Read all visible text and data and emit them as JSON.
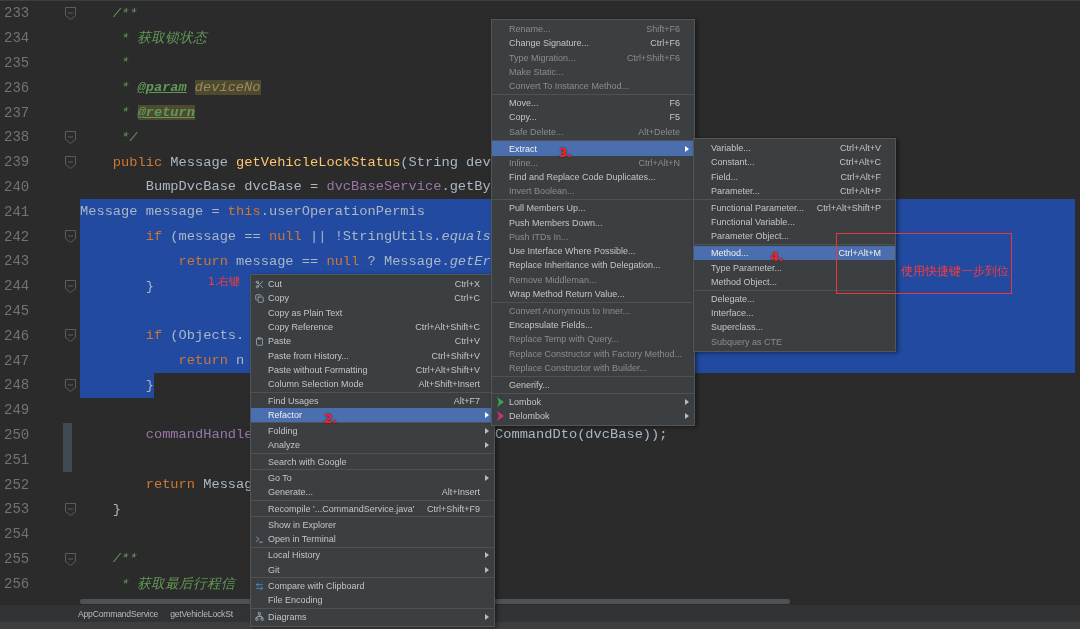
{
  "editor": {
    "lines": [
      {
        "number": "233",
        "fold": true,
        "changed": false,
        "selected": false,
        "tokens": [
          {
            "kind": "comment",
            "text": "    /**"
          }
        ]
      },
      {
        "number": "234",
        "fold": false,
        "changed": false,
        "selected": false,
        "tokens": [
          {
            "kind": "comment",
            "text": "     * 获取锁状态"
          }
        ]
      },
      {
        "number": "235",
        "fold": false,
        "changed": false,
        "selected": false,
        "tokens": [
          {
            "kind": "comment",
            "text": "     *"
          }
        ]
      },
      {
        "number": "236",
        "fold": false,
        "changed": false,
        "selected": false,
        "tokens": [
          {
            "kind": "comment",
            "text": "     * "
          },
          {
            "kind": "doctag",
            "text": "@param"
          },
          {
            "kind": "docparam_marked",
            "text": "deviceNo"
          }
        ]
      },
      {
        "number": "237",
        "fold": false,
        "changed": false,
        "selected": false,
        "tokens": [
          {
            "kind": "comment",
            "text": "     * "
          },
          {
            "kind": "doctag_marked",
            "text": "@return"
          }
        ]
      },
      {
        "number": "238",
        "fold": true,
        "changed": false,
        "selected": false,
        "tokens": [
          {
            "kind": "comment",
            "text": "     */"
          }
        ]
      },
      {
        "number": "239",
        "fold": true,
        "changed": false,
        "selected": false,
        "tokens": [
          {
            "kind": "keyword",
            "text": "    public"
          },
          {
            "kind": "plain",
            "text": " Message "
          },
          {
            "kind": "method",
            "text": "getVehicleLockStatus"
          },
          {
            "kind": "plain",
            "text": "(String dev"
          }
        ]
      },
      {
        "number": "240",
        "fold": false,
        "changed": false,
        "selected": false,
        "tokens": [
          {
            "kind": "plain",
            "text": "        BumpDvcBase dvcBase = "
          },
          {
            "kind": "field",
            "text": "dvcBaseService"
          },
          {
            "kind": "plain",
            "text": ".getBy"
          }
        ]
      },
      {
        "number": "241",
        "fold": false,
        "changed": false,
        "selected": true,
        "selection_starts_at_code": true,
        "tokens": [
          {
            "kind": "plain",
            "text": "        Message message = "
          },
          {
            "kind": "keyword",
            "text": "this"
          },
          {
            "kind": "plain",
            "text": ".userOperationPermis"
          }
        ]
      },
      {
        "number": "242",
        "fold": true,
        "changed": false,
        "selected": true,
        "tokens": [
          {
            "kind": "keyword",
            "text": "        if"
          },
          {
            "kind": "plain",
            "text": " (message == "
          },
          {
            "kind": "keyword",
            "text": "null"
          },
          {
            "kind": "plain",
            "text": " || !StringUtils."
          },
          {
            "kind": "static",
            "text": "equals"
          }
        ]
      },
      {
        "number": "243",
        "fold": false,
        "changed": false,
        "selected": true,
        "tokens": [
          {
            "kind": "keyword",
            "text": "            return"
          },
          {
            "kind": "plain",
            "text": " message == "
          },
          {
            "kind": "keyword",
            "text": "null"
          },
          {
            "kind": "plain",
            "text": " ? Message."
          },
          {
            "kind": "static",
            "text": "getEr"
          }
        ]
      },
      {
        "number": "244",
        "fold": true,
        "changed": false,
        "selected": true,
        "note": "1.右键",
        "tokens": [
          {
            "kind": "plain",
            "text": "        }"
          }
        ]
      },
      {
        "number": "245",
        "fold": false,
        "changed": false,
        "selected": true
      },
      {
        "number": "246",
        "fold": true,
        "changed": false,
        "selected": true,
        "tokens": [
          {
            "kind": "keyword",
            "text": "        if"
          },
          {
            "kind": "plain",
            "text": " (Objects."
          }
        ]
      },
      {
        "number": "247",
        "fold": false,
        "changed": false,
        "selected": true,
        "tokens": [
          {
            "kind": "keyword",
            "text": "            return"
          },
          {
            "kind": "plain",
            "text": " n"
          }
        ]
      },
      {
        "number": "248",
        "fold": true,
        "changed": false,
        "selected": true,
        "selection_ends_at_code": true,
        "tokens": [
          {
            "kind": "plain",
            "text": "        }"
          }
        ]
      },
      {
        "number": "249",
        "fold": false,
        "changed": false,
        "selected": false
      },
      {
        "number": "250",
        "fold": false,
        "changed": true,
        "selected": false,
        "tokens": [
          {
            "kind": "field",
            "text": "        commandHandle"
          }
        ],
        "tail": "CommandDto(dvcBase));"
      },
      {
        "number": "251",
        "fold": false,
        "changed": true,
        "selected": false
      },
      {
        "number": "252",
        "fold": false,
        "changed": false,
        "selected": false,
        "tokens": [
          {
            "kind": "keyword",
            "text": "        return"
          },
          {
            "kind": "plain",
            "text": " Messag"
          }
        ]
      },
      {
        "number": "253",
        "fold": true,
        "changed": false,
        "selected": false,
        "tokens": [
          {
            "kind": "plain",
            "text": "    }"
          }
        ]
      },
      {
        "number": "254",
        "fold": false,
        "changed": false,
        "selected": false
      },
      {
        "number": "255",
        "fold": true,
        "changed": false,
        "selected": false,
        "tokens": [
          {
            "kind": "comment",
            "text": "    /**"
          }
        ]
      },
      {
        "number": "256",
        "fold": false,
        "changed": false,
        "selected": false,
        "tokens": [
          {
            "kind": "comment",
            "text": "     * 获取最后行程信"
          }
        ]
      }
    ]
  },
  "breadcrumb": [
    "AppCommandService",
    "getVehicleLockSt"
  ],
  "context_menu": {
    "groups": [
      [
        {
          "label": "Cut",
          "shortcut": "Ctrl+X",
          "kind": "cut",
          "selected": false,
          "disabled": false
        },
        {
          "label": "Copy",
          "shortcut": "Ctrl+C",
          "kind": "copy",
          "selected": false,
          "disabled": false
        },
        {
          "label": "Copy as Plain Text",
          "selected": false,
          "disabled": false
        },
        {
          "label": "Copy Reference",
          "shortcut": "Ctrl+Alt+Shift+C",
          "selected": false,
          "disabled": false
        },
        {
          "label": "Paste",
          "shortcut": "Ctrl+V",
          "kind": "paste",
          "selected": false,
          "disabled": false
        },
        {
          "label": "Paste from History...",
          "shortcut": "Ctrl+Shift+V",
          "selected": false,
          "disabled": false
        },
        {
          "label": "Paste without Formatting",
          "shortcut": "Ctrl+Alt+Shift+V",
          "selected": false,
          "disabled": false
        },
        {
          "label": "Column Selection Mode",
          "shortcut": "Alt+Shift+Insert",
          "selected": false,
          "disabled": false
        }
      ],
      [
        {
          "label": "Find Usages",
          "shortcut": "Alt+F7",
          "selected": false,
          "disabled": false
        },
        {
          "label": "Refactor",
          "selected": true,
          "disabled": false,
          "submenu": true,
          "note": "2."
        }
      ],
      [
        {
          "label": "Folding",
          "selected": false,
          "disabled": false,
          "submenu": true
        },
        {
          "label": "Analyze",
          "selected": false,
          "disabled": false,
          "submenu": true
        }
      ],
      [
        {
          "label": "Search with Google",
          "selected": false,
          "disabled": false
        }
      ],
      [
        {
          "label": "Go To",
          "selected": false,
          "disabled": false,
          "submenu": true
        },
        {
          "label": "Generate...",
          "shortcut": "Alt+Insert",
          "selected": false,
          "disabled": false
        }
      ],
      [
        {
          "label": "Recompile '...CommandService.java'",
          "shortcut": "Ctrl+Shift+F9",
          "selected": false,
          "disabled": false
        }
      ],
      [
        {
          "label": "Show in Explorer",
          "selected": false,
          "disabled": false
        },
        {
          "label": "Open in Terminal",
          "kind": "terminal",
          "selected": false,
          "disabled": false
        }
      ],
      [
        {
          "label": "Local History",
          "selected": false,
          "disabled": false,
          "submenu": true
        },
        {
          "label": "Git",
          "selected": false,
          "disabled": false,
          "submenu": true
        }
      ],
      [
        {
          "label": "Compare with Clipboard",
          "kind": "compare",
          "selected": false,
          "disabled": false
        },
        {
          "label": "File Encoding",
          "selected": false,
          "disabled": false
        }
      ],
      [
        {
          "label": "Diagrams",
          "kind": "diagrams",
          "selected": false,
          "disabled": false,
          "submenu": true
        }
      ]
    ]
  },
  "refactor_menu": {
    "groups": [
      [
        {
          "label": "Rename...",
          "shortcut": "Shift+F6",
          "selected": false,
          "disabled": true
        },
        {
          "label": "Change Signature...",
          "shortcut": "Ctrl+F6",
          "selected": false,
          "disabled": false
        },
        {
          "label": "Type Migration...",
          "shortcut": "Ctrl+Shift+F6",
          "selected": false,
          "disabled": true
        },
        {
          "label": "Make Static...",
          "selected": false,
          "disabled": true
        },
        {
          "label": "Convert To Instance Method...",
          "selected": false,
          "disabled": true
        }
      ],
      [
        {
          "label": "Move...",
          "shortcut": "F6",
          "selected": false,
          "disabled": false
        },
        {
          "label": "Copy...",
          "shortcut": "F5",
          "selected": false,
          "disabled": false
        },
        {
          "label": "Safe Delete...",
          "shortcut": "Alt+Delete",
          "selected": false,
          "disabled": true
        }
      ],
      [
        {
          "label": "Extract",
          "selected": true,
          "disabled": false,
          "submenu": true,
          "note": "3."
        },
        {
          "label": "Inline...",
          "shortcut": "Ctrl+Alt+N",
          "selected": false,
          "disabled": true
        },
        {
          "label": "Find and Replace Code Duplicates...",
          "selected": false,
          "disabled": false
        },
        {
          "label": "Invert Boolean...",
          "selected": false,
          "disabled": true
        }
      ],
      [
        {
          "label": "Pull Members Up...",
          "selected": false,
          "disabled": false
        },
        {
          "label": "Push Members Down...",
          "selected": false,
          "disabled": false
        },
        {
          "label": "Push ITDs In...",
          "selected": false,
          "disabled": true
        },
        {
          "label": "Use Interface Where Possible...",
          "selected": false,
          "disabled": false
        },
        {
          "label": "Replace Inheritance with Delegation...",
          "selected": false,
          "disabled": false
        },
        {
          "label": "Remove Middleman...",
          "selected": false,
          "disabled": true
        },
        {
          "label": "Wrap Method Return Value...",
          "selected": false,
          "disabled": false
        }
      ],
      [
        {
          "label": "Convert Anonymous to Inner...",
          "selected": false,
          "disabled": true
        },
        {
          "label": "Encapsulate Fields...",
          "selected": false,
          "disabled": false
        },
        {
          "label": "Replace Temp with Query...",
          "selected": false,
          "disabled": true
        },
        {
          "label": "Replace Constructor with Factory Method...",
          "selected": false,
          "disabled": true
        },
        {
          "label": "Replace Constructor with Builder...",
          "selected": false,
          "disabled": true
        }
      ],
      [
        {
          "label": "Generify...",
          "selected": false,
          "disabled": false
        }
      ],
      [
        {
          "label": "Lombok",
          "kind": "lombok",
          "selected": false,
          "disabled": false,
          "submenu": true
        },
        {
          "label": "Delombok",
          "kind": "delombok",
          "selected": false,
          "disabled": false,
          "submenu": true
        }
      ]
    ]
  },
  "extract_menu": {
    "callout": "使用快捷键一步到位",
    "groups": [
      [
        {
          "label": "Variable...",
          "shortcut": "Ctrl+Alt+V",
          "selected": false,
          "disabled": false
        },
        {
          "label": "Constant...",
          "shortcut": "Ctrl+Alt+C",
          "selected": false,
          "disabled": false
        },
        {
          "label": "Field...",
          "shortcut": "Ctrl+Alt+F",
          "selected": false,
          "disabled": false
        },
        {
          "label": "Parameter...",
          "shortcut": "Ctrl+Alt+P",
          "selected": false,
          "disabled": false
        }
      ],
      [
        {
          "label": "Functional Parameter...",
          "shortcut": "Ctrl+Alt+Shift+P",
          "selected": false,
          "disabled": false
        },
        {
          "label": "Functional Variable...",
          "selected": false,
          "disabled": false
        },
        {
          "label": "Parameter Object...",
          "selected": false,
          "disabled": false
        }
      ],
      [
        {
          "label": "Method...",
          "shortcut": "Ctrl+Alt+M",
          "selected": true,
          "disabled": false,
          "note": "4."
        },
        {
          "label": "Type Parameter...",
          "selected": false,
          "disabled": false
        },
        {
          "label": "Method Object...",
          "selected": false,
          "disabled": false
        }
      ],
      [
        {
          "label": "Delegate...",
          "selected": false,
          "disabled": false
        },
        {
          "label": "Interface...",
          "selected": false,
          "disabled": false
        },
        {
          "label": "Superclass...",
          "selected": false,
          "disabled": false
        },
        {
          "label": "Subquery as CTE",
          "selected": false,
          "disabled": true
        }
      ]
    ]
  }
}
